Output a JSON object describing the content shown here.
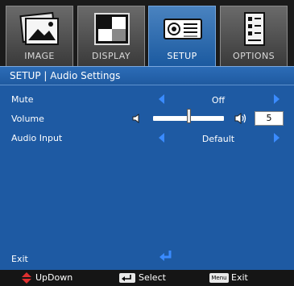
{
  "tabs": [
    {
      "label": "IMAGE",
      "icon": "image-icon",
      "active": false
    },
    {
      "label": "DISPLAY",
      "icon": "display-icon",
      "active": false
    },
    {
      "label": "SETUP",
      "icon": "setup-icon",
      "active": true
    },
    {
      "label": "OPTIONS",
      "icon": "options-icon",
      "active": false
    }
  ],
  "panel": {
    "title": "SETUP | Audio Settings",
    "mute": {
      "label": "Mute",
      "value": "Off"
    },
    "volume": {
      "label": "Volume",
      "value": "5",
      "level_fraction": 0.5
    },
    "audio_input": {
      "label": "Audio Input",
      "value": "Default"
    },
    "exit_label": "Exit"
  },
  "statusbar": {
    "updown": "UpDown",
    "select": "Select",
    "menu_key": "Menu",
    "exit": "Exit"
  },
  "colors": {
    "panel": "#1e5aa3",
    "accent_arrow": "#3a8bff",
    "updown_icon": "#e03030"
  }
}
